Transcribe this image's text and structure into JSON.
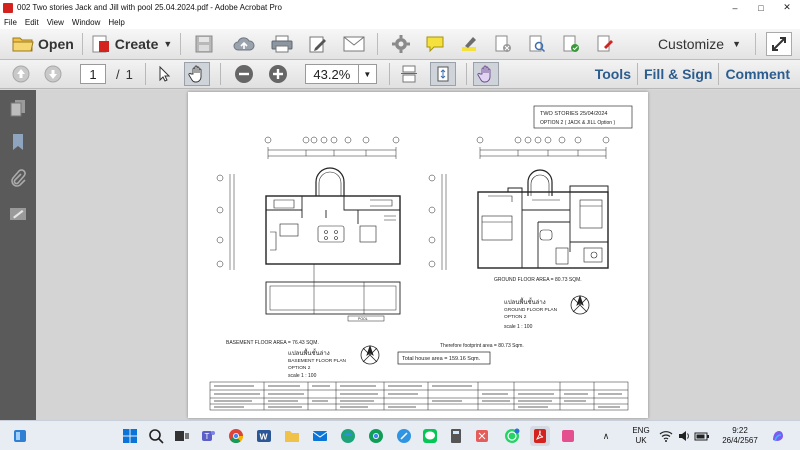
{
  "window": {
    "title": "002 Two stories Jack and Jill with pool 25.04.2024.pdf - Adobe Acrobat Pro"
  },
  "menu": [
    "File",
    "Edit",
    "View",
    "Window",
    "Help"
  ],
  "toolbar": {
    "open_label": "Open",
    "create_label": "Create",
    "customize_label": "Customize"
  },
  "nav": {
    "current_page": "1",
    "separator": "/",
    "total_pages": "1",
    "zoom": "43.2%",
    "tools_label": "Tools",
    "fill_sign_label": "Fill & Sign",
    "comment_label": "Comment"
  },
  "drawing": {
    "title_line1": "TWO STORIES   25/04/2024",
    "title_line2": "OPTION 2  ( JACK & JILL Option )",
    "left_plan": {
      "area": "BASEMENT FLOOR AREA = 76.43 SQM.",
      "thai": "แปลนพื้นชั้นล่าง",
      "name": "BASEMENT FLOOR PLAN",
      "option": "OPTION 2",
      "scale": "scale 1 :   100"
    },
    "right_plan": {
      "area": "GROUND FLOOR AREA = 80.73 SQM.",
      "thai": "แปลนพื้นชั้นล่าง",
      "name": "GROUND FLOOR PLAN",
      "option": "OPTION 2",
      "scale": "scale 1 :   100"
    },
    "footprint": "Therefore footprint area   = 80.73 Sqm.",
    "total_area": "Total house area = 159.16 Sqm.",
    "pool_label": "POOL"
  },
  "taskbar": {
    "lang_line1": "ENG",
    "lang_line2": "UK",
    "time": "9:22",
    "date": "26/4/2567"
  },
  "colors": {
    "acrobat_red": "#d4231f",
    "panel_link_blue": "#2c5d8f",
    "left_rail": "#5a5a5a"
  }
}
